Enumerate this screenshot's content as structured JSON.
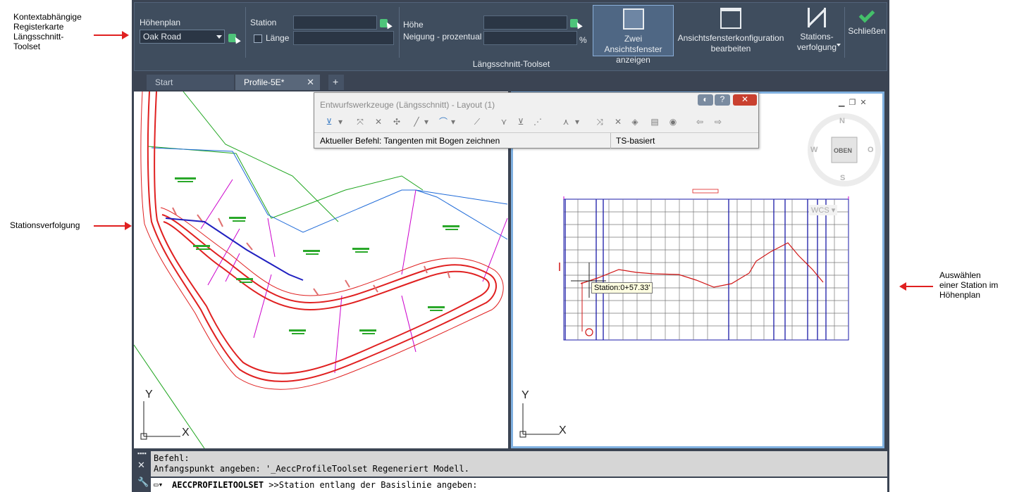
{
  "annotations": {
    "context_tab": [
      "Kontextabhängige",
      "Registerkarte",
      "Längsschnitt-",
      "Toolset"
    ],
    "station_tracking": "Stationsverfolgung",
    "select_station": [
      "Auswählen",
      "einer Station im",
      "Höhenplan"
    ]
  },
  "ribbon": {
    "hoehenplan_label": "Höhenplan",
    "hoehenplan_value": "Oak Road",
    "station_label": "Station",
    "laenge_label": "Länge",
    "hoehe_label": "Höhe",
    "neigung_label": "Neigung - prozentual",
    "percent": "%",
    "btn_two_vp": "Zwei Ansichtsfenster anzeigen",
    "btn_vp_config": "Ansichtsfensterkonfiguration bearbeiten",
    "btn_station_tracking": "Stations-verfolgung",
    "btn_close": "Schließen",
    "panel_title": "Längsschnitt-Toolset"
  },
  "tabs": {
    "start": "Start",
    "current": "Profile-5E*",
    "plus": "+"
  },
  "edtools": {
    "title": "Entwurfswerkzeuge (Längsschnitt) - Layout (1)",
    "current_command": "Aktueller Befehl: Tangenten mit Bogen zeichnen",
    "mode": "TS-basiert"
  },
  "viewport_right": {
    "compass_n": "N",
    "compass_s": "S",
    "compass_w": "W",
    "compass_o": "O",
    "compass_center": "OBEN",
    "wcs": "WCS",
    "station_tooltip": "Station:0+57.33'"
  },
  "axes": {
    "y": "Y",
    "x": "X"
  },
  "command": {
    "hist1": "Befehl:",
    "hist2": "Anfangspunkt angeben: '_AeccProfileToolset Regeneriert Modell.",
    "prompt_cmd": "AECCPROFILETOOLSET",
    "prompt_rest": " >>Station entlang der Basislinie angeben:"
  },
  "colors": {
    "ribbon_bg": "#3f4d5e",
    "road_red": "#e02020",
    "parcel_magenta": "#cc00cc",
    "grid_blue": "#1a1aa8",
    "check_green": "#44c06a"
  }
}
